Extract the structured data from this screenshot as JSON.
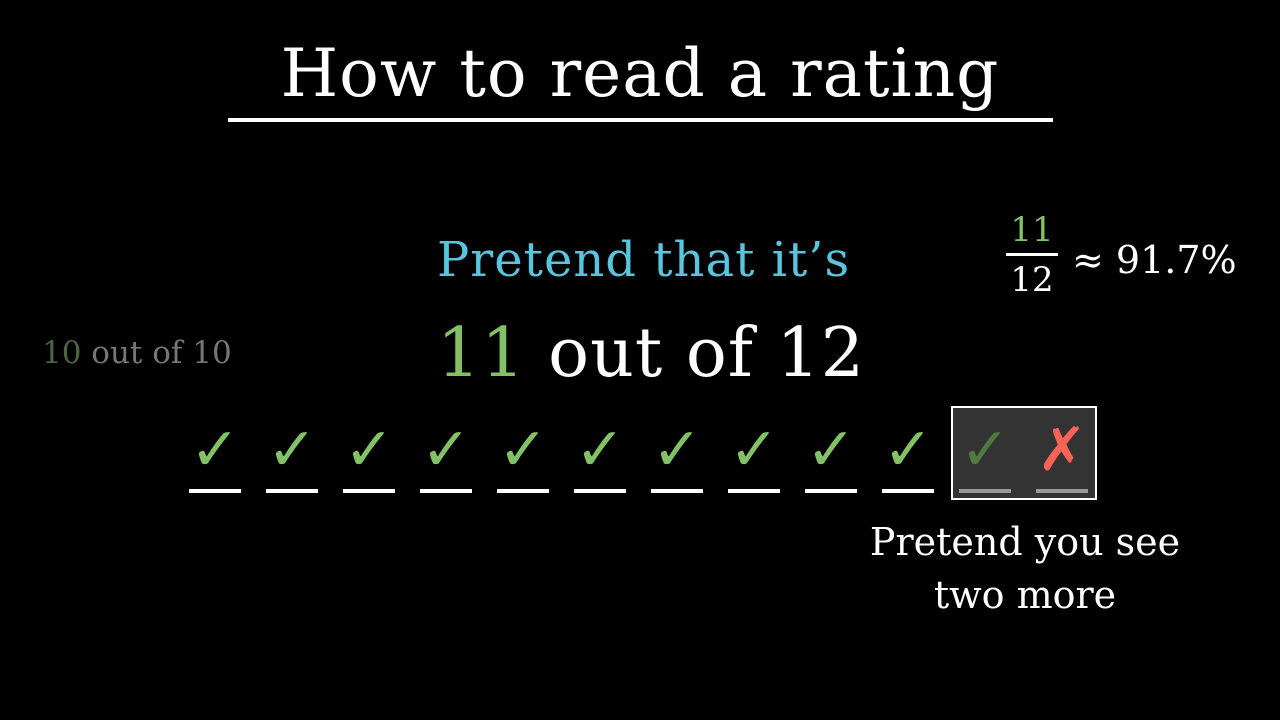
{
  "title": "How to read a rating",
  "pretend_text": "Pretend that it’s",
  "adjusted": {
    "positive": "11",
    "rest": " out of 12"
  },
  "original": {
    "positive": "10",
    "rest": " out of 10"
  },
  "fraction": {
    "numerator": "11",
    "denominator": "12",
    "approx": "≈ 91.7%"
  },
  "caption": {
    "line1": "Pretend you see",
    "line2": "two more"
  },
  "marks": [
    {
      "symbol": "✓",
      "kind": "check"
    },
    {
      "symbol": "✓",
      "kind": "check"
    },
    {
      "symbol": "✓",
      "kind": "check"
    },
    {
      "symbol": "✓",
      "kind": "check"
    },
    {
      "symbol": "✓",
      "kind": "check"
    },
    {
      "symbol": "✓",
      "kind": "check"
    },
    {
      "symbol": "✓",
      "kind": "check"
    },
    {
      "symbol": "✓",
      "kind": "check"
    },
    {
      "symbol": "✓",
      "kind": "check"
    },
    {
      "symbol": "✓",
      "kind": "check"
    },
    {
      "symbol": "✓",
      "kind": "check",
      "extra": true
    },
    {
      "symbol": "✗",
      "kind": "cross",
      "extra": true
    }
  ],
  "colors": {
    "background": "#000000",
    "blue": "#58c4dd",
    "green": "#83c167",
    "red": "#fc6255",
    "highlight_box": "#333333"
  },
  "icons": {
    "check": "check-mark-icon",
    "cross": "cross-mark-icon"
  }
}
